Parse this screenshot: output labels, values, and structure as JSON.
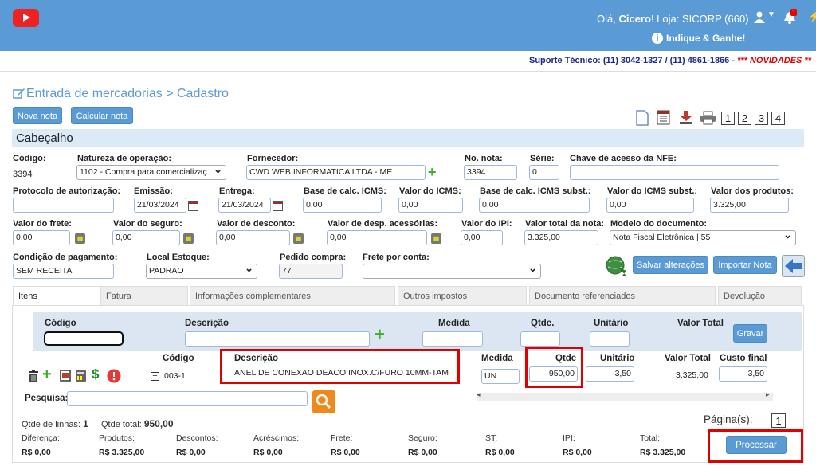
{
  "header": {
    "greeting": "Olá,",
    "user": "Cicero",
    "store": "! Loja: SICORP (660)",
    "notif_count": "1",
    "indique": "Indique & Ganhe!"
  },
  "support": {
    "text": "Suporte Técnico: (11) 3042-1327 / (11) 4861-1866 - ",
    "news": "*** NOVIDADES **"
  },
  "page": {
    "title": "Entrada de mercadorias > Cadastro",
    "nova_nota": "Nova nota",
    "calcular_nota": "Calcular nota",
    "pages": [
      "1",
      "2",
      "3",
      "4"
    ]
  },
  "section": {
    "title": "Cabeçalho"
  },
  "form": {
    "codigo_label": "Código:",
    "codigo_value": "3394",
    "natureza_label": "Natureza de operação:",
    "natureza_value": "1102 - Compra para comercializaç",
    "fornecedor_label": "Fornecedor:",
    "fornecedor_value": "CWD WEB INFORMATICA LTDA - ME",
    "nonota_label": "No. nota:",
    "nonota_value": "3394",
    "serie_label": "Série:",
    "serie_value": "0",
    "chave_label": "Chave de acesso da NFE:",
    "chave_value": "",
    "protocolo_label": "Protocolo de autorização:",
    "protocolo_value": "",
    "emissao_label": "Emissão:",
    "emissao_value": "21/03/2024",
    "entrega_label": "Entrega:",
    "entrega_value": "21/03/2024",
    "base_icms_label": "Base de calc. ICMS:",
    "base_icms_value": "0,00",
    "valor_icms_label": "Valor do ICMS:",
    "valor_icms_value": "0,00",
    "base_icms_st_label": "Base de calc. ICMS subst.:",
    "base_icms_st_value": "0,00",
    "valor_icms_st_label": "Valor do ICMS subst.:",
    "valor_icms_st_value": "0,00",
    "valor_produtos_label": "Valor dos produtos:",
    "valor_produtos_value": "3.325,00",
    "frete_label": "Valor do frete:",
    "frete_value": "0,00",
    "seguro_label": "Valor do seguro:",
    "seguro_value": "0,00",
    "desconto_label": "Valor de desconto:",
    "desconto_value": "0,00",
    "despesas_label": "Valor de desp. acessórias:",
    "despesas_value": "0,00",
    "ipi_label": "Valor do IPI:",
    "ipi_value": "0,00",
    "total_nota_label": "Valor total da nota:",
    "total_nota_value": "3.325,00",
    "modelo_label": "Modelo do documento:",
    "modelo_value": "Nota Fiscal Eletrônica | 55",
    "condicao_label": "Condição de pagamento:",
    "condicao_value": "SEM RECEITA",
    "local_label": "Local Estoque:",
    "local_value": "PADRAO",
    "pedido_label": "Pedido compra:",
    "pedido_value": "77",
    "frete_conta_label": "Frete por conta:",
    "frete_conta_value": "",
    "salvar": "Salvar alterações",
    "importar": "Importar Nota"
  },
  "tabs": [
    "Itens",
    "Fatura",
    "Informações complementares",
    "Outros impostos",
    "Documento referenciados",
    "Devolução"
  ],
  "add_item": {
    "codigo": "Código",
    "descricao": "Descrição",
    "medida": "Medida",
    "qtde": "Qtde.",
    "unitario": "Unitário",
    "valor_total": "Valor Total",
    "gravar": "Gravar"
  },
  "items_header": {
    "codigo": "Código",
    "descricao": "Descrição",
    "medida": "Medida",
    "qtde": "Qtde",
    "unitario": "Unitário",
    "valor_total": "Valor Total",
    "custo_final": "Custo final"
  },
  "item": {
    "codigo": "003-1",
    "descricao": "ANEL DE CONEXAO DEACO INOX.C/FURO 10MM-TAM",
    "medida": "UN",
    "qtde": "950,00",
    "unitario": "3,50",
    "valor_total": "3.325,00",
    "custo_final": "3,50"
  },
  "search": {
    "label": "Pesquisa:"
  },
  "summary": {
    "qtde_linhas_label": "Qtde de linhas:",
    "qtde_linhas": "1",
    "qtde_total_label": "Qtde total:",
    "qtde_total": "950,00",
    "pagina_label": "Página(s):",
    "pagina": "1",
    "cols": [
      {
        "label": "Diferença:",
        "value": "R$ 0,00"
      },
      {
        "label": "Produtos:",
        "value": "R$ 3.325,00"
      },
      {
        "label": "Descontos:",
        "value": "R$ 0,00"
      },
      {
        "label": "Acréscimos:",
        "value": "R$ 0,00"
      },
      {
        "label": "Frete:",
        "value": "R$ 0,00"
      },
      {
        "label": "Seguro:",
        "value": "R$ 0,00"
      },
      {
        "label": "ST:",
        "value": "R$ 0,00"
      },
      {
        "label": "IPI:",
        "value": "R$ 0,00"
      },
      {
        "label": "Total:",
        "value": "R$ 3.325,00"
      }
    ],
    "processar": "Processar"
  }
}
